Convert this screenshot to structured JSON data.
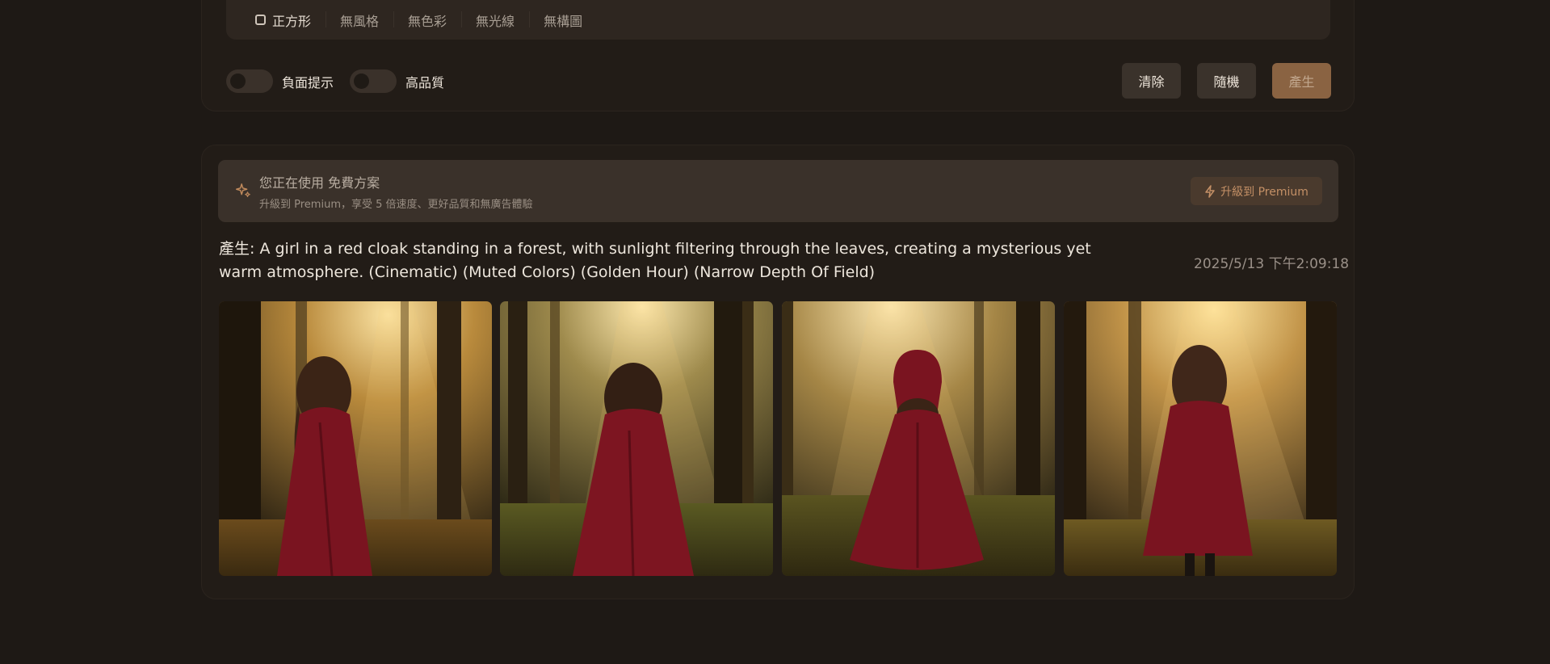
{
  "style_bar": {
    "chips": [
      {
        "label": "正方形",
        "checkbox": true
      },
      {
        "label": "無風格"
      },
      {
        "label": "無色彩"
      },
      {
        "label": "無光線"
      },
      {
        "label": "無構圖"
      }
    ]
  },
  "options": {
    "negative_prompt_label": "負面提示",
    "high_quality_label": "高品質",
    "negative_prompt_on": false,
    "high_quality_on": false
  },
  "actions": {
    "clear_label": "清除",
    "random_label": "隨機",
    "generate_label": "產生"
  },
  "banner": {
    "title": "您正在使用 免費方案",
    "subtitle": "升級到 Premium，享受 5 倍速度、更好品質和無廣告體驗",
    "upgrade_label": "升級到 Premium",
    "icon": "sparkle-icon",
    "upgrade_icon": "lightning-icon"
  },
  "result": {
    "prompt": "產生: A girl in a red cloak standing in a forest, with sunlight filtering through the leaves, creating a mysterious yet warm atmosphere. (Cinematic) (Muted Colors) (Golden Hour) (Narrow Depth Of Field)",
    "timestamp": "2025/5/13 下午2:09:18",
    "images": [
      {
        "hood": false
      },
      {
        "hood": false
      },
      {
        "hood": true
      },
      {
        "hood": false
      }
    ]
  },
  "colors": {
    "background": "#1e1915",
    "accent": "#8a6342",
    "cloak": "#7a1420",
    "light": "#f6d07a"
  }
}
